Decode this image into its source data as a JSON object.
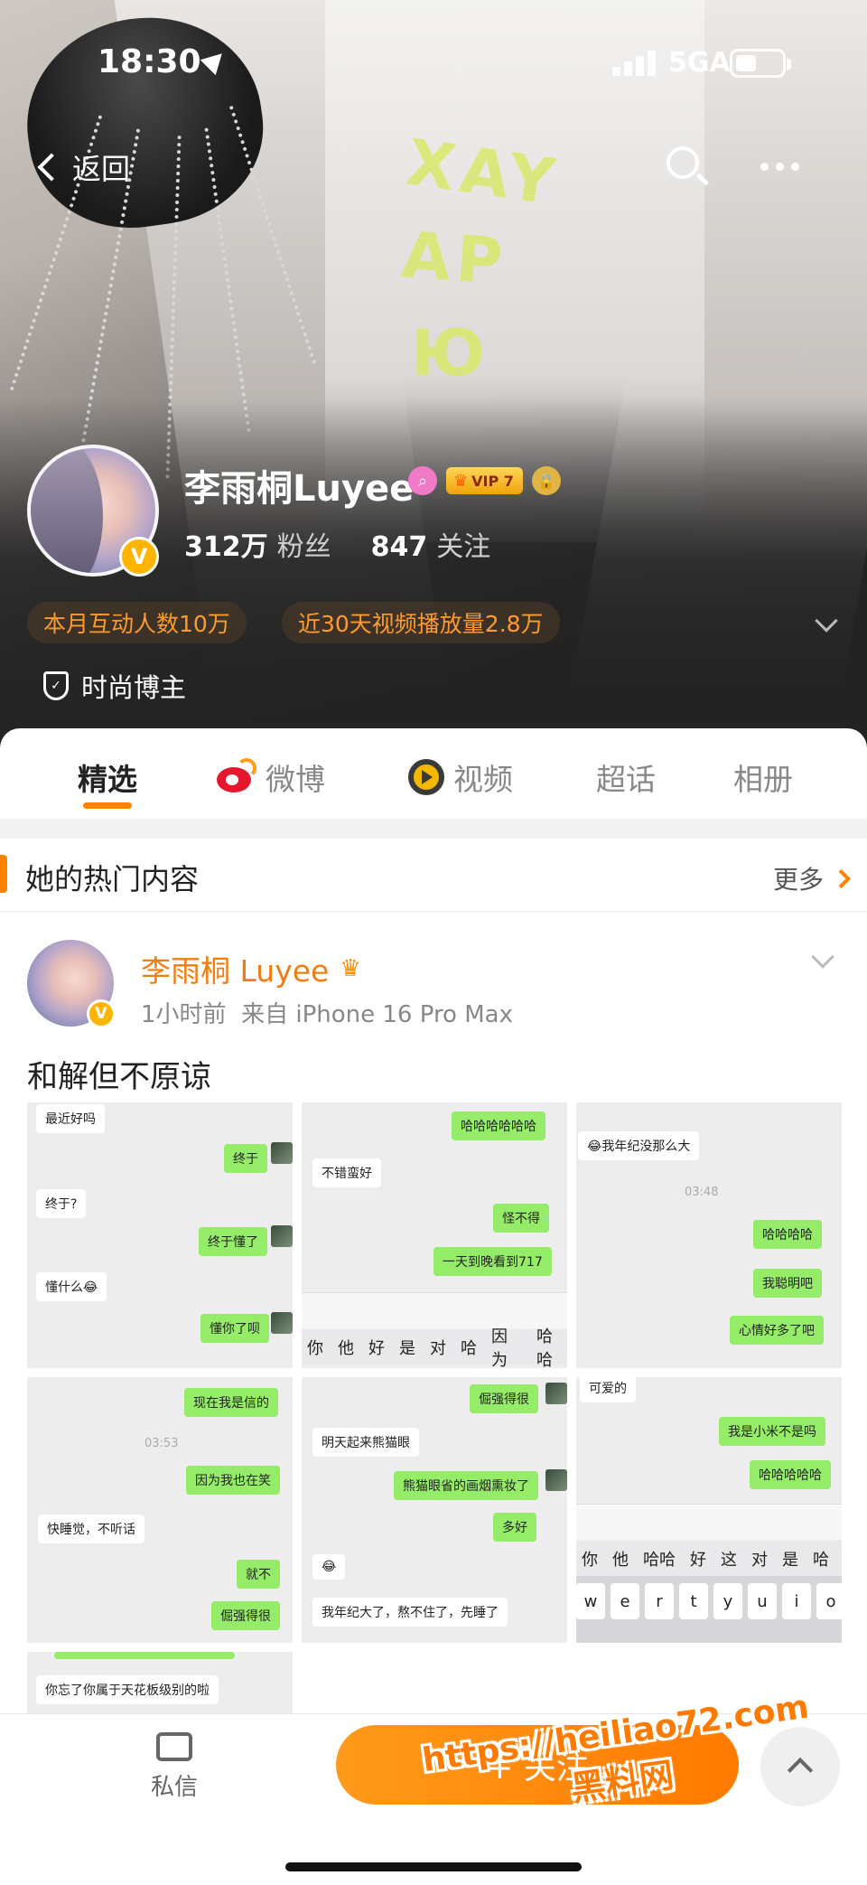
{
  "status_bar": {
    "time": "18:30",
    "network": "5GA"
  },
  "nav": {
    "back_label": "返回"
  },
  "hero": {
    "shirt_lines": [
      "XAY",
      "AP",
      "Ю"
    ]
  },
  "profile": {
    "name": "李雨桐Luyee",
    "vip_label": "VIP 7",
    "followers_count": "312万",
    "followers_label": "粉丝",
    "following_count": "847",
    "following_label": "关注",
    "stat_pill_1": "本月互动人数10万",
    "stat_pill_2": "近30天视频播放量2.8万",
    "certification": "时尚博主",
    "verified_badge": "V"
  },
  "tabs": [
    {
      "label": "精选",
      "active": true
    },
    {
      "label": "微博",
      "active": false
    },
    {
      "label": "视频",
      "active": false
    },
    {
      "label": "超话",
      "active": false
    },
    {
      "label": "相册",
      "active": false
    }
  ],
  "section": {
    "title": "她的热门内容",
    "more_label": "更多"
  },
  "post": {
    "author": "李雨桐 Luyee",
    "time": "1小时前",
    "source": "来自 iPhone 16 Pro Max",
    "text": "和解但不原谅",
    "images": [
      {
        "messages": [
          "最近好吗",
          "终于",
          "终于?",
          "终于懂了",
          "懂什么😂",
          "懂你了呗"
        ]
      },
      {
        "messages": [
          "哈哈哈哈哈哈",
          "不错蛮好",
          "怪不得",
          "一天到晚看到717"
        ],
        "candidates": [
          "你",
          "他",
          "好",
          "是",
          "对",
          "哈",
          "因为",
          "哈哈"
        ]
      },
      {
        "messages": [
          "😂我年纪没那么大",
          "03:48",
          "哈哈哈哈",
          "我聪明吧",
          "心情好多了吧"
        ]
      },
      {
        "messages": [
          "现在我是信的",
          "03:53",
          "因为我也在笑",
          "快睡觉，不听话",
          "就不",
          "倔强得很"
        ]
      },
      {
        "messages": [
          "倔强得很",
          "明天起来熊猫眼",
          "熊猫眼省的画烟熏妆了",
          "多好",
          "😂",
          "我年纪大了，熬不住了，先睡了"
        ]
      },
      {
        "messages": [
          "可爱的",
          "我是小米不是吗",
          "哈哈哈哈哈"
        ],
        "candidates": [
          "你",
          "他",
          "哈哈",
          "好",
          "这",
          "对",
          "是",
          "哈"
        ],
        "keys": [
          "w",
          "e",
          "r",
          "t",
          "y",
          "u",
          "i",
          "o"
        ]
      },
      {
        "messages": [
          "你忘了你属于天花板级别的啦"
        ]
      }
    ]
  },
  "bottom_bar": {
    "dm_label": "私信",
    "follow_label": "+ 关注"
  },
  "watermark": {
    "url": "https://heiliao72.com",
    "name": "黑料网"
  }
}
